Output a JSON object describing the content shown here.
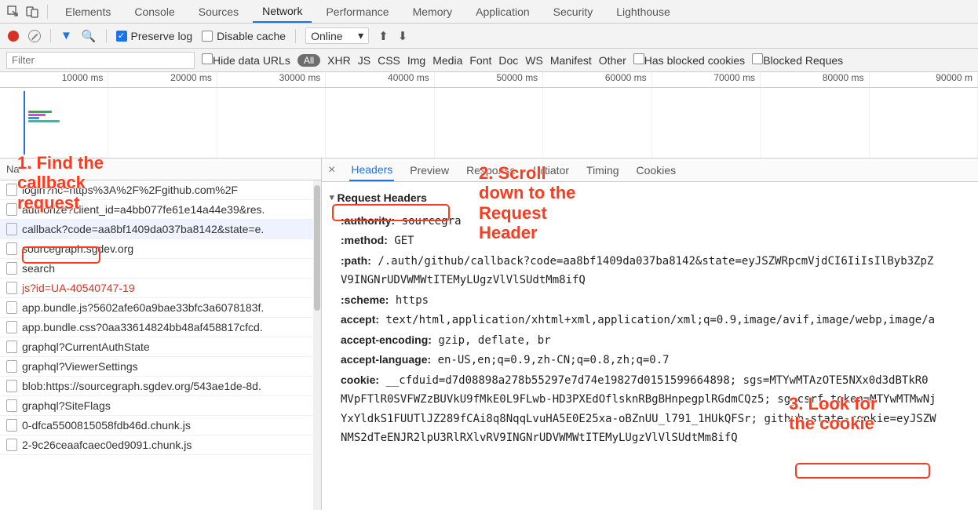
{
  "top_tabs": {
    "items": [
      "Elements",
      "Console",
      "Sources",
      "Network",
      "Performance",
      "Memory",
      "Application",
      "Security",
      "Lighthouse"
    ],
    "active": 3
  },
  "toolbar": {
    "preserve_log": "Preserve log",
    "disable_cache": "Disable cache",
    "throttle": "Online"
  },
  "filterbar": {
    "placeholder": "Filter",
    "hide_data_urls": "Hide data URLs",
    "all": "All",
    "types": [
      "XHR",
      "JS",
      "CSS",
      "Img",
      "Media",
      "Font",
      "Doc",
      "WS",
      "Manifest",
      "Other"
    ],
    "has_blocked": "Has blocked cookies",
    "blocked_req": "Blocked Reques"
  },
  "timeline": {
    "ticks": [
      "10000 ms",
      "20000 ms",
      "30000 ms",
      "40000 ms",
      "50000 ms",
      "60000 ms",
      "70000 ms",
      "80000 ms",
      "90000 m"
    ]
  },
  "left": {
    "header": "Na",
    "requests": [
      {
        "name": "login?nc=https%3A%2F%2Fgithub.com%2F"
      },
      {
        "name": "authorize?client_id=a4bb077fe61e14a44e39&res."
      },
      {
        "name": "callback?code=aa8bf1409da037ba8142&state=e.",
        "selected": true
      },
      {
        "name": "sourcegraph.sgdev.org"
      },
      {
        "name": "search"
      },
      {
        "name": "js?id=UA-40540747-19",
        "red": true
      },
      {
        "name": "app.bundle.js?5602afe60a9bae33bfc3a6078183f."
      },
      {
        "name": "app.bundle.css?0aa33614824bb48af458817cfcd."
      },
      {
        "name": "graphql?CurrentAuthState"
      },
      {
        "name": "graphql?ViewerSettings"
      },
      {
        "name": "blob:https://sourcegraph.sgdev.org/543ae1de-8d."
      },
      {
        "name": "graphql?SiteFlags"
      },
      {
        "name": "0-dfca5500815058fdb46d.chunk.js"
      },
      {
        "name": "2-9c26ceaafcaec0ed9091.chunk.js"
      }
    ]
  },
  "detail": {
    "tabs": [
      "Headers",
      "Preview",
      "Response",
      "Initiator",
      "Timing",
      "Cookies"
    ],
    "section": "Request Headers",
    "headers": {
      "authority": {
        "k": ":authority:",
        "v": "sourcegra"
      },
      "method": {
        "k": ":method:",
        "v": "GET"
      },
      "path": {
        "k": ":path:",
        "v": "/.auth/github/callback?code=aa8bf1409da037ba8142&state=eyJSZWRpcmVjdCI6IiIsIlByb3ZpZ"
      },
      "path2": "V9INGNrUDVWMWtITEMyLUgzVlVlSUdtMm8ifQ",
      "scheme": {
        "k": ":scheme:",
        "v": "https"
      },
      "accept": {
        "k": "accept:",
        "v": "text/html,application/xhtml+xml,application/xml;q=0.9,image/avif,image/webp,image/a"
      },
      "accenc": {
        "k": "accept-encoding:",
        "v": "gzip, deflate, br"
      },
      "acclang": {
        "k": "accept-language:",
        "v": "en-US,en;q=0.9,zh-CN;q=0.8,zh;q=0.7"
      },
      "cookie": {
        "k": "cookie:",
        "v": "__cfduid=d7d08898a278b55297e7d74e19827d0151599664898; sgs=MTYwMTAzOTE5NXx0d3dBTkR0"
      },
      "cookie2": "MVpFTlR0SVFWZzBUVkU9fMkE0L9FLwb-HD3PXEdOflsknRBgBHnpegplRGdmCQz5; sg_csrf_token=MTYwMTMwNj",
      "cookie3a": "YxYldkS1FUUTlJZ289fCAi8q8NqqLvuHA5E0E25xa-oBZnUU_l791_1HUkQFSr; ",
      "cookie3b": "github-state-cookie",
      "cookie3c": "=eyJSZW",
      "cookie4": "NMS2dTeENJR2lpU3RlRXlvRV9INGNrUDVWMWtITEMyLUgzVlVlSUdtMm8ifQ"
    }
  },
  "annotations": {
    "a1": "1. Find the\ncallback\nrequest",
    "a2": "2. Scroll\ndown to the\nRequest\nHeader",
    "a3": "3. Look for\nthe cookie"
  }
}
